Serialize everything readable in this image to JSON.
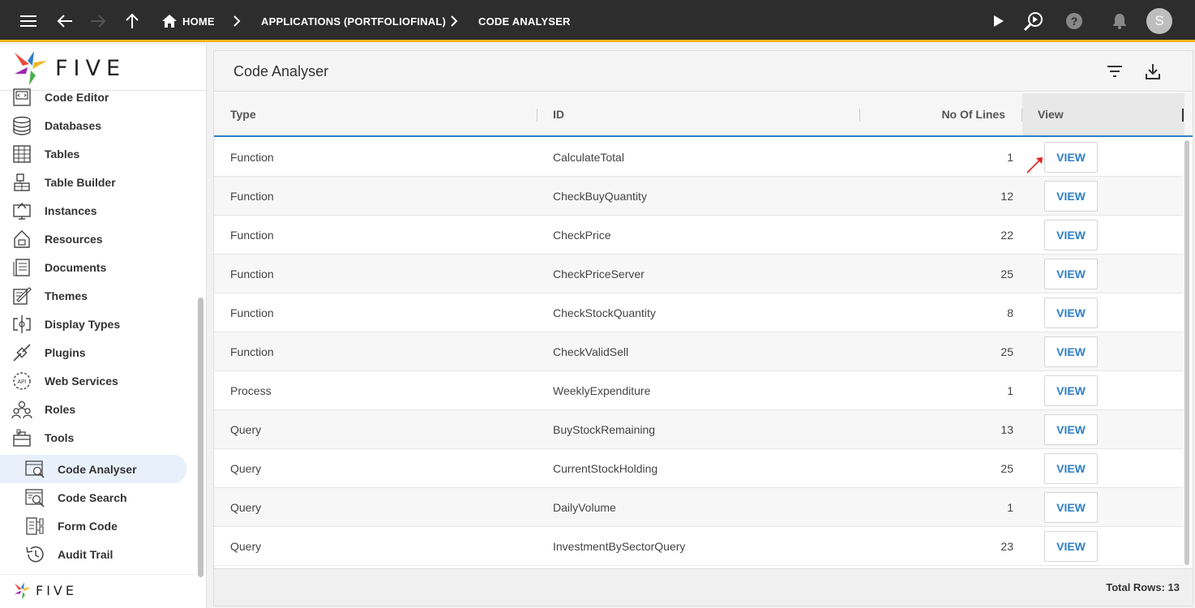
{
  "topbar": {
    "breadcrumbs": [
      "HOME",
      "APPLICATIONS (PORTFOLIOFINAL)",
      "CODE ANALYSER"
    ],
    "avatar_letter": "S",
    "accent_color": "#f0b323"
  },
  "sidebar": {
    "logo_text": "FIVE",
    "items": [
      {
        "label": "Code Editor",
        "icon": "code-editor-icon"
      },
      {
        "label": "Databases",
        "icon": "database-icon"
      },
      {
        "label": "Tables",
        "icon": "table-icon"
      },
      {
        "label": "Table Builder",
        "icon": "table-builder-icon"
      },
      {
        "label": "Instances",
        "icon": "instances-icon"
      },
      {
        "label": "Resources",
        "icon": "resources-icon"
      },
      {
        "label": "Documents",
        "icon": "documents-icon"
      },
      {
        "label": "Themes",
        "icon": "themes-icon"
      },
      {
        "label": "Display Types",
        "icon": "display-types-icon"
      },
      {
        "label": "Plugins",
        "icon": "plugins-icon"
      },
      {
        "label": "Web Services",
        "icon": "web-services-icon"
      },
      {
        "label": "Roles",
        "icon": "roles-icon"
      },
      {
        "label": "Tools",
        "icon": "tools-icon"
      }
    ],
    "sub_items": [
      {
        "label": "Code Analyser",
        "icon": "code-analyser-icon",
        "active": true
      },
      {
        "label": "Code Search",
        "icon": "code-search-icon"
      },
      {
        "label": "Form Code",
        "icon": "form-code-icon"
      },
      {
        "label": "Audit Trail",
        "icon": "audit-trail-icon"
      }
    ],
    "bottom_logo_text": "FIVE"
  },
  "main": {
    "title": "Code Analyser",
    "columns": [
      "Type",
      "ID",
      "No Of Lines",
      "View"
    ],
    "view_label": "VIEW",
    "rows": [
      {
        "type": "Function",
        "id": "CalculateTotal",
        "lines": "1"
      },
      {
        "type": "Function",
        "id": "CheckBuyQuantity",
        "lines": "12"
      },
      {
        "type": "Function",
        "id": "CheckPrice",
        "lines": "22"
      },
      {
        "type": "Function",
        "id": "CheckPriceServer",
        "lines": "25"
      },
      {
        "type": "Function",
        "id": "CheckStockQuantity",
        "lines": "8"
      },
      {
        "type": "Function",
        "id": "CheckValidSell",
        "lines": "25"
      },
      {
        "type": "Process",
        "id": "WeeklyExpenditure",
        "lines": "1"
      },
      {
        "type": "Query",
        "id": "BuyStockRemaining",
        "lines": "13"
      },
      {
        "type": "Query",
        "id": "CurrentStockHolding",
        "lines": "25"
      },
      {
        "type": "Query",
        "id": "DailyVolume",
        "lines": "1"
      },
      {
        "type": "Query",
        "id": "InvestmentBySectorQuery",
        "lines": "23"
      }
    ],
    "total_rows": "Total Rows: 13"
  }
}
